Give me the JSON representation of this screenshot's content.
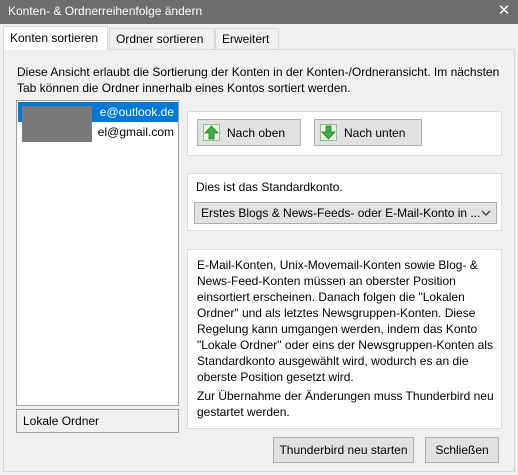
{
  "window": {
    "title": "Konten- & Ordnerreihenfolge ändern",
    "close_glyph": "✕"
  },
  "tabs": [
    {
      "label": "Konten sortieren",
      "active": true
    },
    {
      "label": "Ordner sortieren",
      "active": false
    },
    {
      "label": "Erweitert",
      "active": false
    }
  ],
  "intro": "Diese Ansicht erlaubt die Sortierung der Konten in der Konten-/Ordneransicht. Im nächsten Tab können die Ordner innerhalb eines Kontos sortiert werden.",
  "accounts": [
    {
      "label": "e@outlook.de",
      "selected": true
    },
    {
      "label": "el@gmail.com",
      "selected": false
    }
  ],
  "local_folder": "Lokale Ordner",
  "move": {
    "up_label": "Nach oben",
    "up_icon": "arrow-up-icon",
    "down_label": "Nach unten",
    "down_icon": "arrow-down-icon"
  },
  "default_account": {
    "label": "Dies ist das Standardkonto.",
    "selected": "Erstes Blogs & News-Feeds- oder E-Mail-Konto in ..."
  },
  "info": {
    "paragraph1": "E-Mail-Konten, Unix-Movemail-Konten sowie Blog- & News-Feed-Konten müssen an oberster Position einsortiert erscheinen. Danach folgen die \"Lokalen Ordner\" und als letztes Newsgruppen-Konten. Diese Regelung kann umgangen werden, indem das Konto \"Lokale Ordner\" oder eins der Newsgruppen-Konten als Standardkonto ausgewählt wird, wodurch es an die oberste Position gesetzt wird.",
    "paragraph2": "Zur Übernahme der Änderungen muss Thunderbird neu gestartet werden."
  },
  "footer": {
    "restart_label": "Thunderbird neu starten",
    "close_label": "Schließen"
  },
  "colors": {
    "titlebar": "#6d6d6d",
    "selection": "#0078d7",
    "arrow_green": "#3fae3f"
  }
}
